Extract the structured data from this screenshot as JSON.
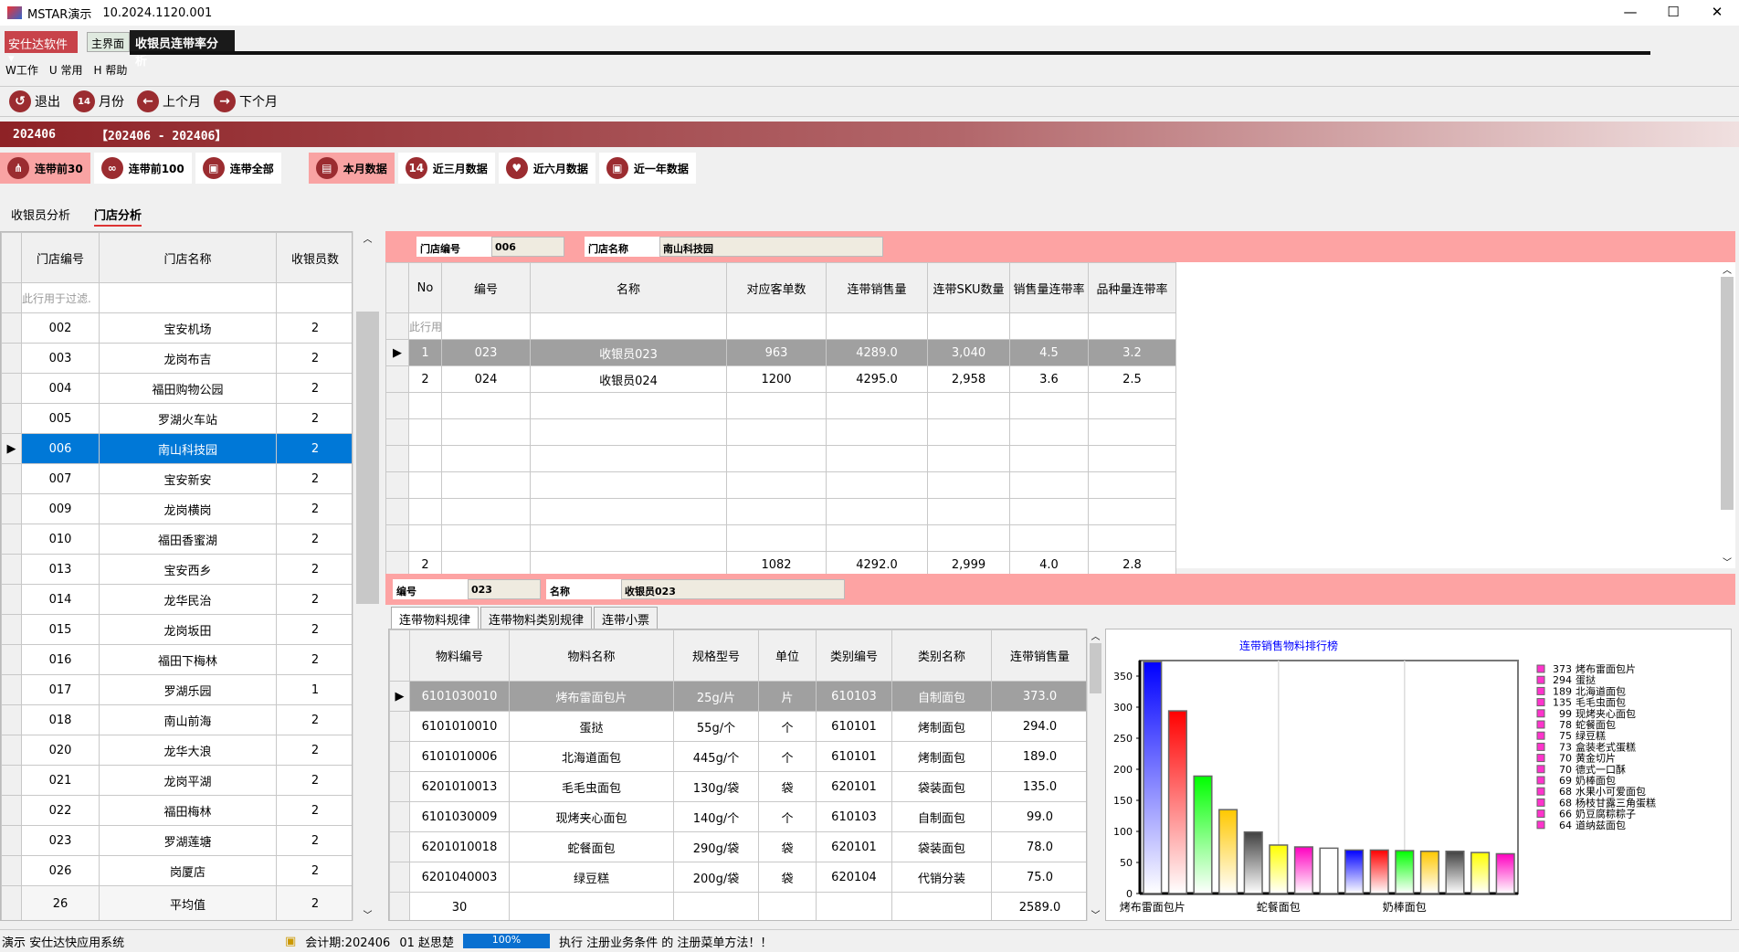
{
  "window": {
    "title": "MSTAR演示",
    "version": "10.2024.1120.001",
    "min": "—",
    "max": "☐",
    "close": "✕"
  },
  "brand": "安仕达软件",
  "app_tabs": [
    "主界面",
    "收银员连带率分析"
  ],
  "menu": [
    "W工作",
    "U 常用",
    "H 帮助"
  ],
  "toolbar": [
    {
      "label": "退出",
      "icon": "↺"
    },
    {
      "label": "月份",
      "icon": "14"
    },
    {
      "label": "上个月",
      "icon": "←"
    },
    {
      "label": "下个月",
      "icon": "→"
    }
  ],
  "banner": {
    "period": "202406",
    "range": "【202406 - 202406】"
  },
  "filters": [
    {
      "label": "连带前30",
      "icon": "⋔",
      "active": true
    },
    {
      "label": "连带前100",
      "icon": "∞"
    },
    {
      "label": "连带全部",
      "icon": "▣"
    },
    {
      "label": "本月数据",
      "icon": "▤",
      "active": true
    },
    {
      "label": "近三月数据",
      "icon": "14"
    },
    {
      "label": "近六月数据",
      "icon": "♥"
    },
    {
      "label": "近一年数据",
      "icon": "▣"
    }
  ],
  "view_tabs": [
    "收银员分析",
    "门店分析"
  ],
  "stores": {
    "headers": [
      "门店编号",
      "门店名称",
      "收银员数"
    ],
    "filter_placeholder": "此行用于过滤.",
    "rows": [
      [
        "002",
        "宝安机场",
        "2"
      ],
      [
        "003",
        "龙岗布吉",
        "2"
      ],
      [
        "004",
        "福田购物公园",
        "2"
      ],
      [
        "005",
        "罗湖火车站",
        "2"
      ],
      [
        "006",
        "南山科技园",
        "2"
      ],
      [
        "007",
        "宝安新安",
        "2"
      ],
      [
        "009",
        "龙岗横岗",
        "2"
      ],
      [
        "010",
        "福田香蜜湖",
        "2"
      ],
      [
        "013",
        "宝安西乡",
        "2"
      ],
      [
        "014",
        "龙华民治",
        "2"
      ],
      [
        "015",
        "龙岗坂田",
        "2"
      ],
      [
        "016",
        "福田下梅林",
        "2"
      ],
      [
        "017",
        "罗湖乐园",
        "1"
      ],
      [
        "018",
        "南山前海",
        "2"
      ],
      [
        "020",
        "龙华大浪",
        "2"
      ],
      [
        "021",
        "龙岗平湖",
        "2"
      ],
      [
        "022",
        "福田梅林",
        "2"
      ],
      [
        "023",
        "罗湖莲塘",
        "2"
      ],
      [
        "026",
        "岗厦店",
        "2"
      ]
    ],
    "footer": [
      "26",
      "平均值",
      "2"
    ],
    "selected_index": 4
  },
  "store_info": {
    "code_label": "门店编号",
    "code": "006",
    "name_label": "门店名称",
    "name": "南山科技园"
  },
  "cashiers": {
    "headers": [
      "No",
      "编号",
      "名称",
      "对应客单数",
      "连带销售量",
      "连带SKU数量",
      "销售量连带率",
      "品种量连带率"
    ],
    "filter_placeholder": "此行用",
    "rows": [
      [
        "1",
        "023",
        "收银员023",
        "963",
        "4289.0",
        "3,040",
        "4.5",
        "3.2"
      ],
      [
        "2",
        "024",
        "收银员024",
        "1200",
        "4295.0",
        "2,958",
        "3.6",
        "2.5"
      ]
    ],
    "footer": [
      "2",
      "",
      "",
      "1082",
      "4292.0",
      "2,999",
      "4.0",
      "2.8"
    ]
  },
  "cashier_info": {
    "code_label": "编号",
    "code": "023",
    "name_label": "名称",
    "name": "收银员023"
  },
  "sub_tabs": [
    "连带物料规律",
    "连带物料类别规律",
    "连带小票"
  ],
  "items": {
    "headers": [
      "物料编号",
      "物料名称",
      "规格型号",
      "单位",
      "类别编号",
      "类别名称",
      "连带销售量"
    ],
    "rows": [
      [
        "6101030010",
        "烤布雷面包片",
        "25g/片",
        "片",
        "610103",
        "自制面包",
        "373.0"
      ],
      [
        "6101010010",
        "蛋挞",
        "55g/个",
        "个",
        "610101",
        "烤制面包",
        "294.0"
      ],
      [
        "6101010006",
        "北海道面包",
        "445g/个",
        "个",
        "610101",
        "烤制面包",
        "189.0"
      ],
      [
        "6201010013",
        "毛毛虫面包",
        "130g/袋",
        "袋",
        "620101",
        "袋装面包",
        "135.0"
      ],
      [
        "6101030009",
        "现烤夹心面包",
        "140g/个",
        "个",
        "610103",
        "自制面包",
        "99.0"
      ],
      [
        "6201010018",
        "蛇餐面包",
        "290g/袋",
        "袋",
        "620101",
        "袋装面包",
        "78.0"
      ],
      [
        "6201040003",
        "绿豆糕",
        "200g/袋",
        "袋",
        "620104",
        "代销分装",
        "75.0"
      ]
    ],
    "footer": [
      "30",
      "",
      "",
      "",
      "",
      "",
      "2589.0"
    ]
  },
  "chart_data": {
    "type": "bar",
    "title": "连带销售物料排行榜",
    "categories": [
      "烤布雷面包片",
      "蛋挞",
      "北海道面包",
      "毛毛虫面包",
      "现烤夹心面包",
      "蛇餐面包",
      "绿豆糕",
      "盒装老式蛋糕",
      "黄金切片",
      "德式一口酥",
      "奶棒面包",
      "水果小可爱面包",
      "杨枝甘露三角蛋糕",
      "奶豆腐粽粽子",
      "道纳兹面包"
    ],
    "values": [
      373,
      294,
      189,
      135,
      99,
      78,
      75,
      73,
      70,
      70,
      69,
      68,
      68,
      66,
      64
    ],
    "colors": [
      "#0000ff",
      "#ff0000",
      "#00ff00",
      "#ffc800",
      "#404040",
      "#ffff00",
      "#ff00c0",
      "#ffffff",
      "#0000ff",
      "#ff0000",
      "#00ff00",
      "#ffc800",
      "#404040",
      "#ffff00",
      "#ff00c0"
    ],
    "yticks": [
      0,
      50,
      100,
      150,
      200,
      250,
      300,
      350
    ],
    "ylim": [
      0,
      375
    ],
    "xtick_labels": [
      "烤布雷面包片",
      "蛇餐面包",
      "奶棒面包"
    ],
    "legend_placement": "right",
    "legend_color": "#ff33cc"
  },
  "status": {
    "app": "演示 安仕达快应用系统",
    "period": "会计期:202406",
    "user": "01 赵思楚",
    "progress": "100%",
    "progress_value": 100,
    "message": "执行 注册业务条件 的 注册菜单方法！！"
  }
}
